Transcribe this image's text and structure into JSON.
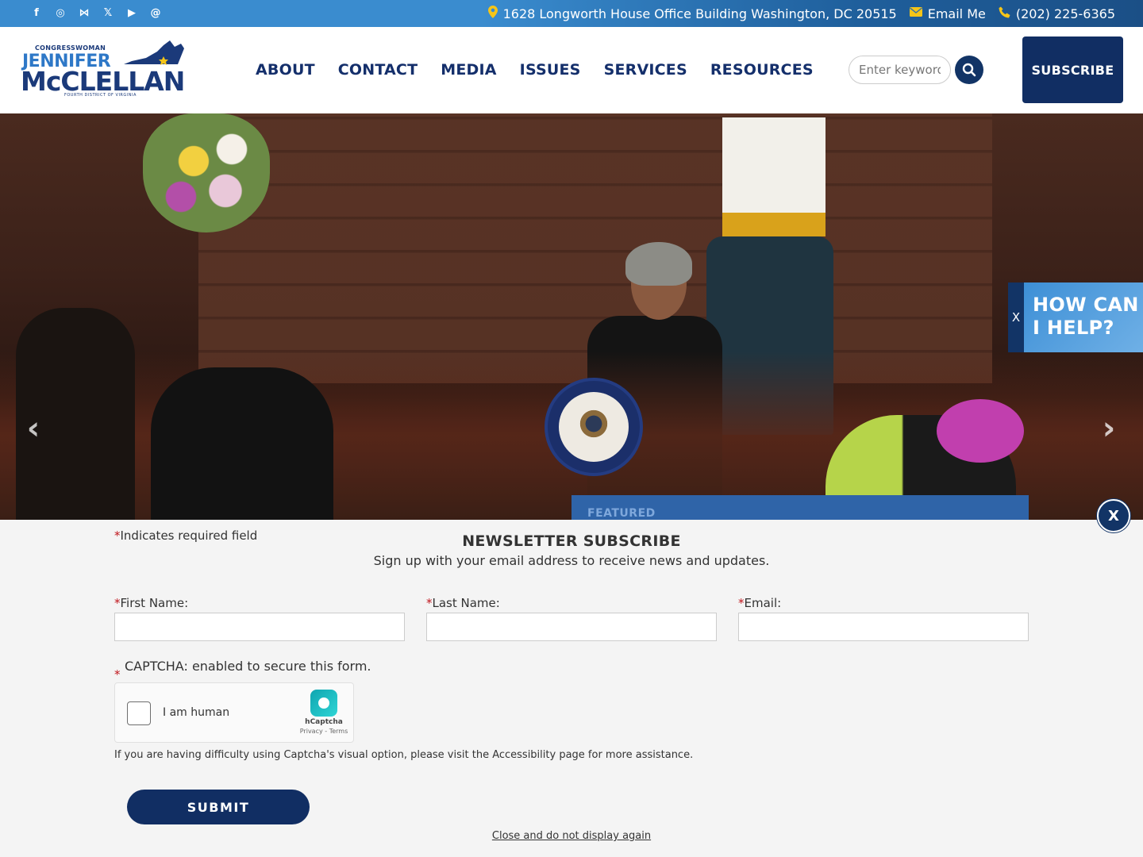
{
  "topbar": {
    "social": [
      {
        "icon": "facebook-icon",
        "glyph": "f"
      },
      {
        "icon": "instagram-icon",
        "glyph": "◎"
      },
      {
        "icon": "bluesky-icon",
        "glyph": "⋈"
      },
      {
        "icon": "x-twitter-icon",
        "glyph": "𝕏"
      },
      {
        "icon": "youtube-icon",
        "glyph": "▶"
      },
      {
        "icon": "threads-icon",
        "glyph": "@"
      }
    ],
    "address": "1628 Longworth House Office Building Washington, DC 20515",
    "email_label": "Email Me",
    "phone": "(202) 225-6365"
  },
  "logo": {
    "line1": "CONGRESSWOMAN",
    "line2": "JENNIFER",
    "line3": "McCLELLAN",
    "line4": "FOURTH DISTRICT OF VIRGINIA"
  },
  "nav": {
    "items": [
      "ABOUT",
      "CONTACT",
      "MEDIA",
      "ISSUES",
      "SERVICES",
      "RESOURCES"
    ]
  },
  "search": {
    "placeholder": "Enter keyword"
  },
  "header": {
    "subscribe_label": "SUBSCRIBE"
  },
  "hero": {
    "featured_label": "FEATURED",
    "prev_glyph": "‹",
    "next_glyph": "›"
  },
  "help_tab": {
    "close_label": "X",
    "line1": "HOW CAN",
    "line2": "I HELP?"
  },
  "newsletter": {
    "close_label": "X",
    "required_note": "Indicates required field",
    "title": "NEWSLETTER SUBSCRIBE",
    "subtitle": "Sign up with your email address to receive news and updates.",
    "fields": {
      "first_name": "First Name:",
      "last_name": "Last Name:",
      "email": "Email:"
    },
    "captcha_label": "CAPTCHA: enabled to secure this form.",
    "captcha": {
      "checkbox_label": "I am human",
      "brand": "hCaptcha",
      "links": "Privacy - Terms"
    },
    "accessibility_note": "If you are having difficulty using Captcha's visual option, please visit the Accessibility page for more assistance.",
    "submit_label": "SUBMIT",
    "dismiss_label": "Close and do not display again"
  },
  "colors": {
    "navy": "#112e63",
    "accent_blue": "#3a8ccf",
    "required_red": "#c0161c",
    "icon_gold": "#f5c518"
  }
}
